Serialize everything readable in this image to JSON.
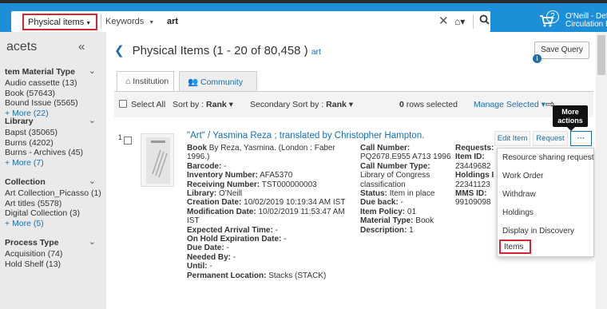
{
  "header": {
    "scope_label": "Physical items",
    "field_label": "Keywords",
    "query_value": "art",
    "cart_count": "2",
    "user_line1": "O'Neill - Defa",
    "user_line2": "Circulation D",
    "colors": {
      "topbar": "#1d8fd9",
      "scope_border": "#d9262e"
    }
  },
  "facets": {
    "title": "acets",
    "collapse_label": "«",
    "groups": [
      {
        "title": "tem Material Type",
        "items": [
          "Audio cassette (13)",
          "Book (57643)",
          "Bound Issue (5565)"
        ],
        "more": "More (22)"
      },
      {
        "title": "Library",
        "items": [
          "Bapst (35065)",
          "Burns (4202)",
          "Burns - Archives (45)"
        ],
        "more": "More (7)"
      },
      {
        "title": "Collection",
        "items": [
          "Art Collection_Picasso (1)",
          "Art titles (5578)",
          "Digital Collection (3)"
        ],
        "more": "More (5)"
      },
      {
        "title": "Process Type",
        "items": [
          "Acquisition (74)",
          "Hold Shelf (13)"
        ],
        "more": ""
      }
    ]
  },
  "main": {
    "title": "Physical Items (1 - 20 of 80,458 )",
    "query_tag": "art",
    "save_query": "Save Query",
    "tabs": [
      "Institution",
      "Community"
    ],
    "toolbar": {
      "select_all": "Select All",
      "sort_by_label": "Sort by :",
      "sort_by_value": "Rank",
      "secondary_sort_label": "Secondary Sort by :",
      "secondary_sort_value": "Rank",
      "rows_selected_count": "0",
      "rows_selected_label": "rows selected",
      "manage_selected": "Manage Selected"
    },
    "tooltip": "More actions"
  },
  "record": {
    "number": "1",
    "title": "\"Art\" / Yasmina Reza ; translated by Christopher Hampton.",
    "col1": [
      {
        "label": "Book",
        "value": "By Reza, Yasmina. (London : Faber"
      },
      {
        "label": "",
        "value": "1996.)"
      },
      {
        "label": "Barcode:",
        "value": "-"
      },
      {
        "label": "Inventory Number:",
        "value": "AFA5370"
      },
      {
        "label": "Receiving Number:",
        "value": "TST000000003"
      },
      {
        "label": "Library:",
        "value": "O'Neill"
      },
      {
        "label": "Creation Date:",
        "value": "10/02/2019 10:19:34 AM IST"
      },
      {
        "label": "Modification Date:",
        "value": "10/02/2019 11:53:47 AM"
      },
      {
        "label": "",
        "value": "IST"
      },
      {
        "label": "Expected Arrival Time:",
        "value": "-"
      },
      {
        "label": "On Hold Expiration Date:",
        "value": "-"
      },
      {
        "label": "Due Date:",
        "value": "-"
      },
      {
        "label": "Needed By:",
        "value": "-"
      },
      {
        "label": "Until:",
        "value": "-"
      },
      {
        "label": "Permanent Location:",
        "value": "Stacks (STACK)"
      }
    ],
    "col2": [
      {
        "label": "Call Number:",
        "value": ""
      },
      {
        "label": "",
        "value": "PQ2678.E955 A713 1996"
      },
      {
        "label": "Call Number Type:",
        "value": ""
      },
      {
        "label": "",
        "value": "Library of Congress"
      },
      {
        "label": "",
        "value": "classification"
      },
      {
        "label": "Status:",
        "value": "Item in place"
      },
      {
        "label": "Due back:",
        "value": "-"
      },
      {
        "label": "Item Policy:",
        "value": "01"
      },
      {
        "label": "Material Type:",
        "value": "Book"
      },
      {
        "label": "Description:",
        "value": "1"
      }
    ],
    "col3": [
      {
        "label": "Requests:",
        "value": ""
      },
      {
        "label": "Item ID:",
        "value": ""
      },
      {
        "label": "",
        "value": "23449682"
      },
      {
        "label": "Holdings I",
        "value": ""
      },
      {
        "label": "",
        "value": "22341123"
      },
      {
        "label": "MMS ID:",
        "value": ""
      },
      {
        "label": "",
        "value": "99109098"
      }
    ],
    "actions": {
      "edit_item": "Edit Item",
      "request": "Request",
      "more": "···"
    }
  },
  "menu": {
    "items": [
      "Resource sharing request",
      "Work Order",
      "Withdraw",
      "Holdings",
      "Display in Discovery",
      "Items"
    ]
  }
}
